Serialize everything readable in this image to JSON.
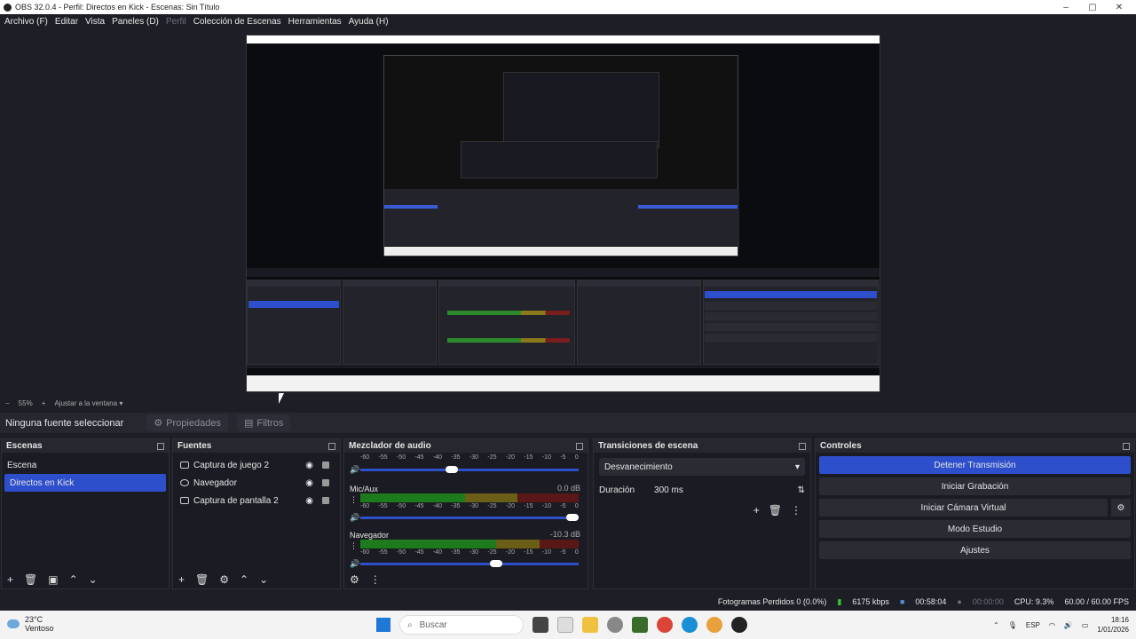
{
  "window": {
    "title": "OBS 32.0.4 - Perfil: Directos en Kick - Escenas: Sin Título",
    "min": "–",
    "max": "▢",
    "close": "✕"
  },
  "menu": [
    "Archivo (F)",
    "Editar",
    "Vista",
    "Paneles (D)",
    "Perfil",
    "Colección de Escenas",
    "Herramientas",
    "Ayuda (H)"
  ],
  "zoom": {
    "minus": "−",
    "value": "55%",
    "plus": "+",
    "fit": "Ajustar a la ventana"
  },
  "source_toolbar": {
    "none": "Ninguna fuente seleccionar",
    "properties": "Propiedades",
    "filters": "Filtros"
  },
  "scenes": {
    "title": "Escenas",
    "items": [
      "Escena",
      "Directos en Kick"
    ],
    "selected": 1
  },
  "sources": {
    "title": "Fuentes",
    "items": [
      {
        "name": "Captura de juego 2",
        "icon": "gamepad-icon"
      },
      {
        "name": "Navegador",
        "icon": "globe-icon"
      },
      {
        "name": "Captura de pantalla 2",
        "icon": "monitor-icon"
      }
    ]
  },
  "mixer": {
    "title": "Mezclador de audio",
    "channels": [
      {
        "name": "",
        "db": "",
        "vol": 0.42
      },
      {
        "name": "Mic/Aux",
        "db": "0.0 dB",
        "vol": 0.97,
        "level_green": 0.48,
        "level_yellow": 0.72
      },
      {
        "name": "Navegador",
        "db": "-10.3 dB",
        "vol": 0.62,
        "level_green": 0.62,
        "level_yellow": 0.82
      }
    ],
    "scale": [
      "-60",
      "-55",
      "-50",
      "-45",
      "-40",
      "-35",
      "-30",
      "-25",
      "-20",
      "-15",
      "-10",
      "-5",
      "0"
    ]
  },
  "transitions": {
    "title": "Transiciones de escena",
    "selected": "Desvanecimiento",
    "duration_label": "Duración",
    "duration": "300 ms"
  },
  "controls": {
    "title": "Controles",
    "buttons": [
      "Detener Transmisión",
      "Iniciar Grabación",
      "Iniciar Cámara Virtual",
      "Modo Estudio",
      "Ajustes"
    ]
  },
  "status": {
    "dropped": "Fotogramas Perdidos 0 (0.0%)",
    "bitrate": "6175 kbps",
    "stream_time": "00:58:04",
    "rec_time": "00:00:00",
    "cpu": "CPU: 9.3%",
    "fps": "60.00 / 60.00 FPS"
  },
  "taskbar": {
    "weather": "23°C",
    "weather_desc": "Ventoso",
    "search": "Buscar",
    "lang": "ESP",
    "time": "18:16",
    "date": "1/01/2026"
  },
  "colors": {
    "accent": "#2e4fcc",
    "bg": "#1e1f26"
  }
}
